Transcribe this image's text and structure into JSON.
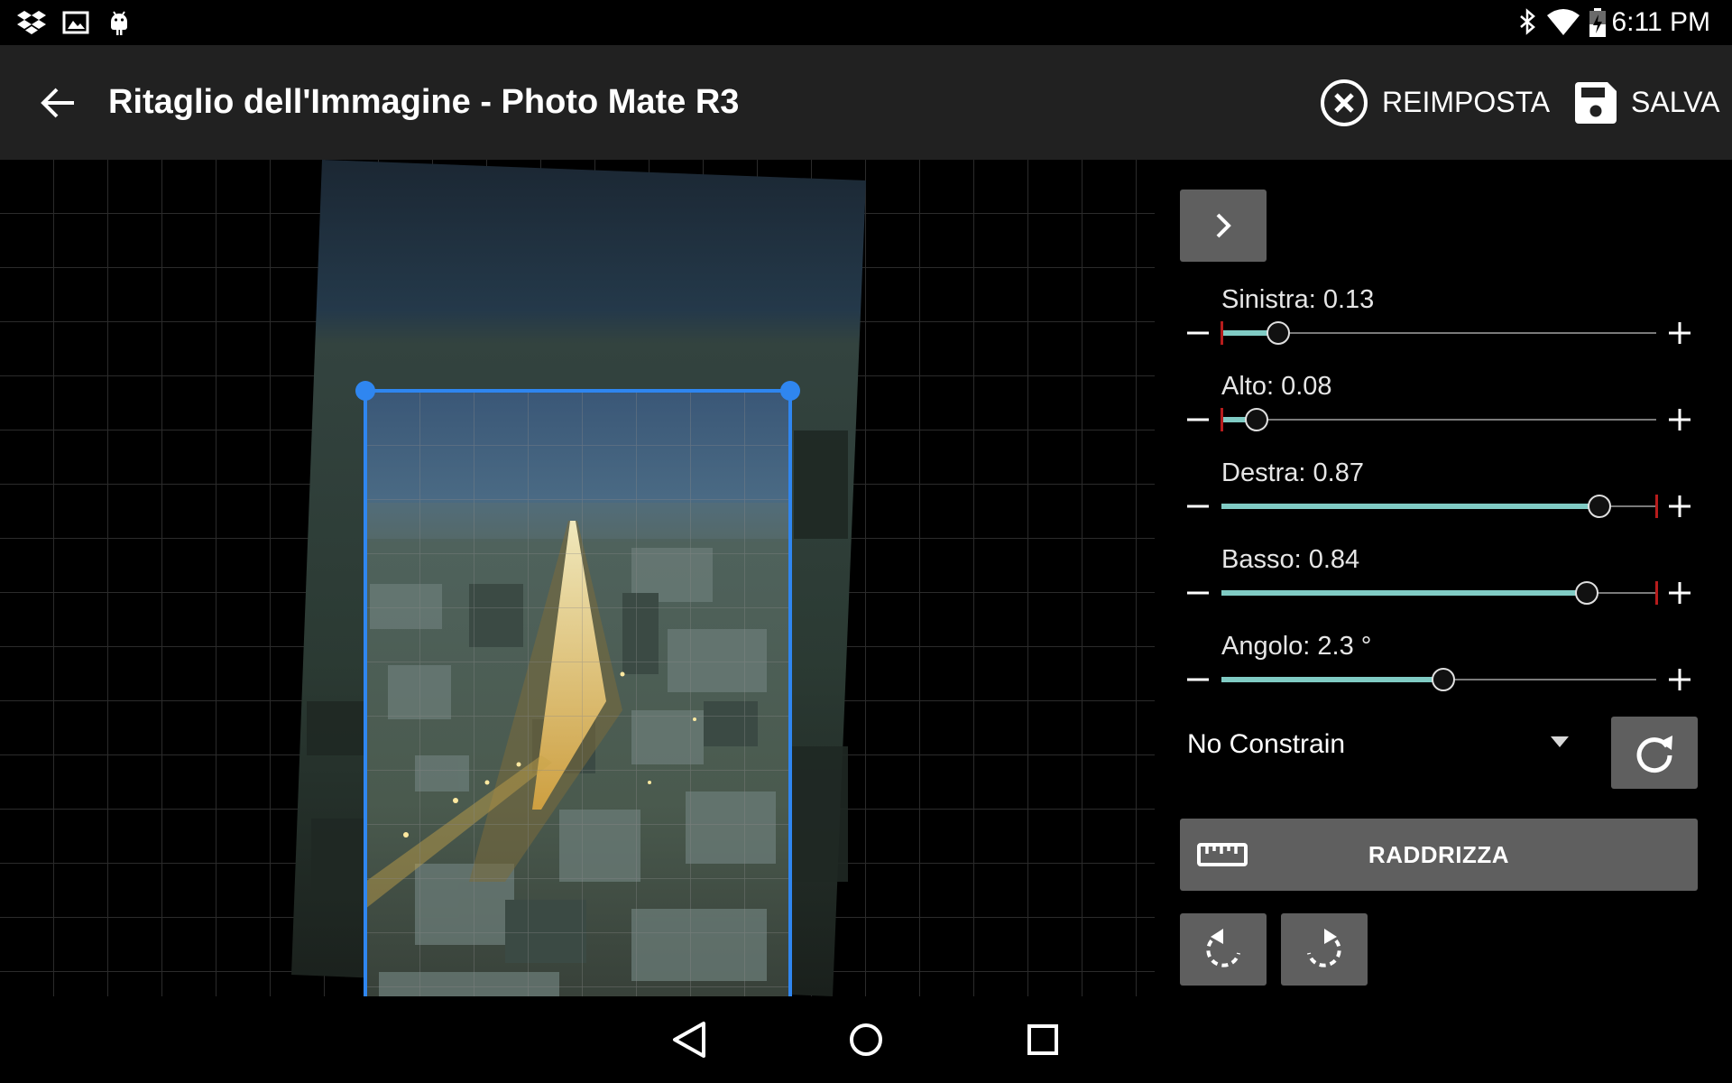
{
  "status_bar": {
    "time": "6:11 PM",
    "icons": [
      "dropbox-icon",
      "image-icon",
      "android-icon",
      "bluetooth-icon",
      "wifi-icon",
      "battery-icon"
    ]
  },
  "action_bar": {
    "title": "Ritaglio dell'Immagine - Photo Mate R3",
    "reset_label": "REIMPOSTA",
    "save_label": "SALVA"
  },
  "sliders": [
    {
      "label": "Sinistra: 0.13",
      "fraction": 0.13,
      "limit": "min"
    },
    {
      "label": "Alto: 0.08",
      "fraction": 0.08,
      "limit": "min"
    },
    {
      "label": "Destra: 0.87",
      "fraction": 0.87,
      "limit": "max"
    },
    {
      "label": "Basso: 0.84",
      "fraction": 0.84,
      "limit": "max"
    },
    {
      "label": "Angolo: 2.3 °",
      "fraction": 0.51,
      "limit": "none"
    }
  ],
  "constraint": {
    "value": "No Constrain"
  },
  "straighten_label": "RADDRIZZA",
  "colors": {
    "accent": "#80cbc4",
    "crop_frame": "#2f86f0",
    "toolbar": "#212121",
    "button": "#5f5f5f"
  }
}
